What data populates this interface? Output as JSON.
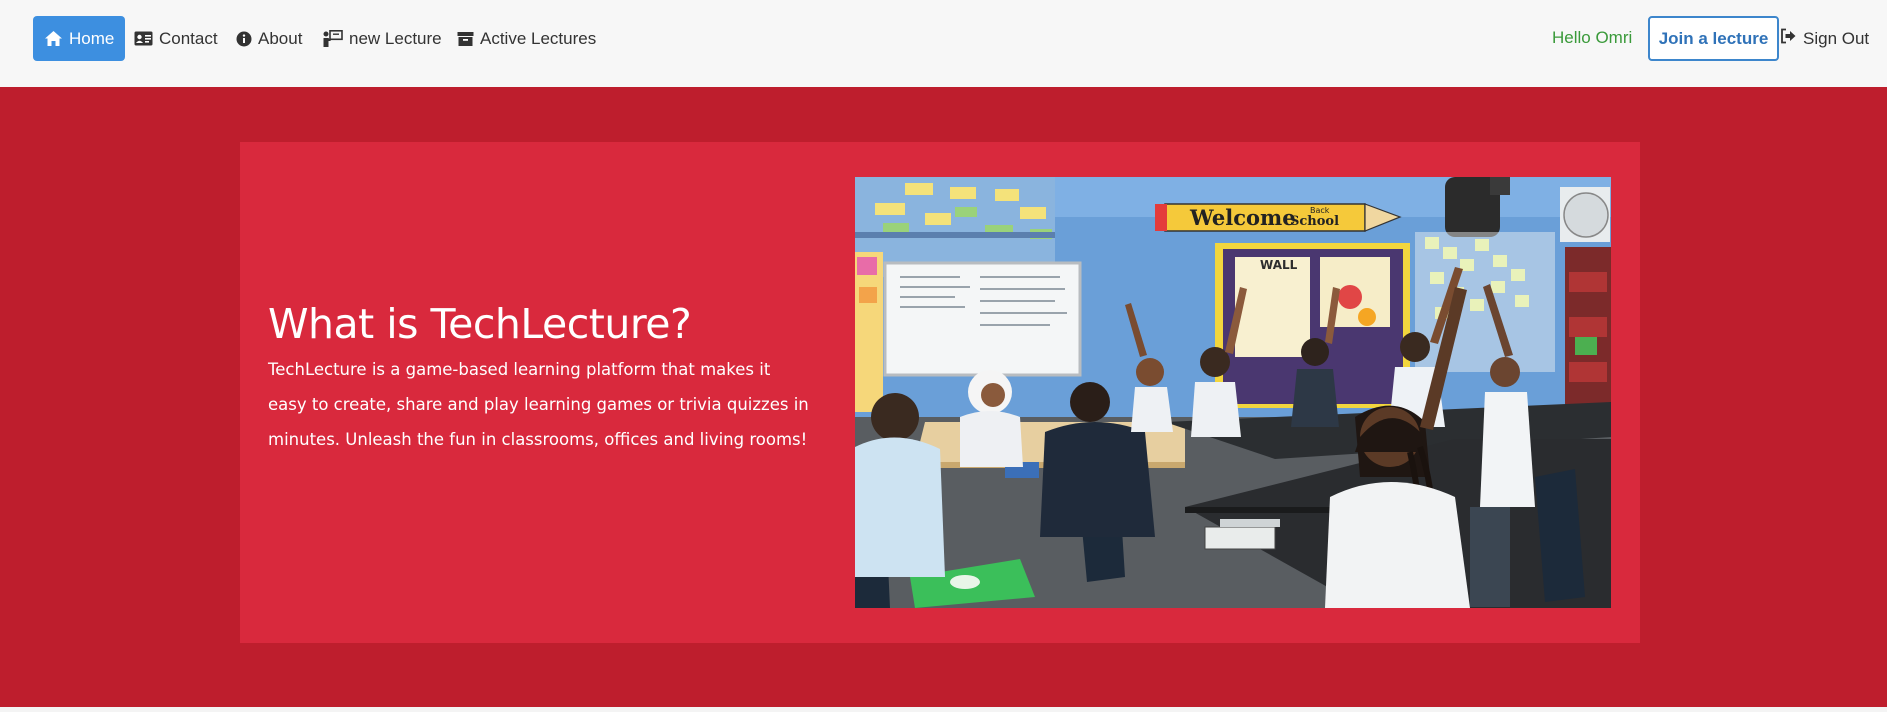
{
  "nav": {
    "items": [
      {
        "label": "Home",
        "icon": "home-icon",
        "active": true
      },
      {
        "label": "Contact",
        "icon": "id-card-icon",
        "active": false
      },
      {
        "label": "About",
        "icon": "info-icon",
        "active": false
      },
      {
        "label": "new Lecture",
        "icon": "presenter-icon",
        "active": false
      },
      {
        "label": "Active Lectures",
        "icon": "archive-icon",
        "active": false
      }
    ],
    "greeting": "Hello Omri",
    "join_label": "Join a lecture",
    "signout_label": "Sign Out"
  },
  "hero": {
    "title": "What is TechLecture?",
    "description": "TechLecture is a game-based learning platform that makes it easy to create, share and play learning games or trivia quizzes in minutes. Unleash the fun in classrooms, offices and living rooms!",
    "image": {
      "banner_text": "Welcome",
      "banner_sub_top": "Back",
      "banner_sub": "School",
      "board_text": "WALL"
    }
  },
  "colors": {
    "nav_bg": "#f7f7f7",
    "active_nav": "#3d8fe0",
    "greeting": "#3a9a3a",
    "join_border": "#3d86cc",
    "hero_bg": "#be1e2d",
    "card_bg": "#d9293d"
  }
}
